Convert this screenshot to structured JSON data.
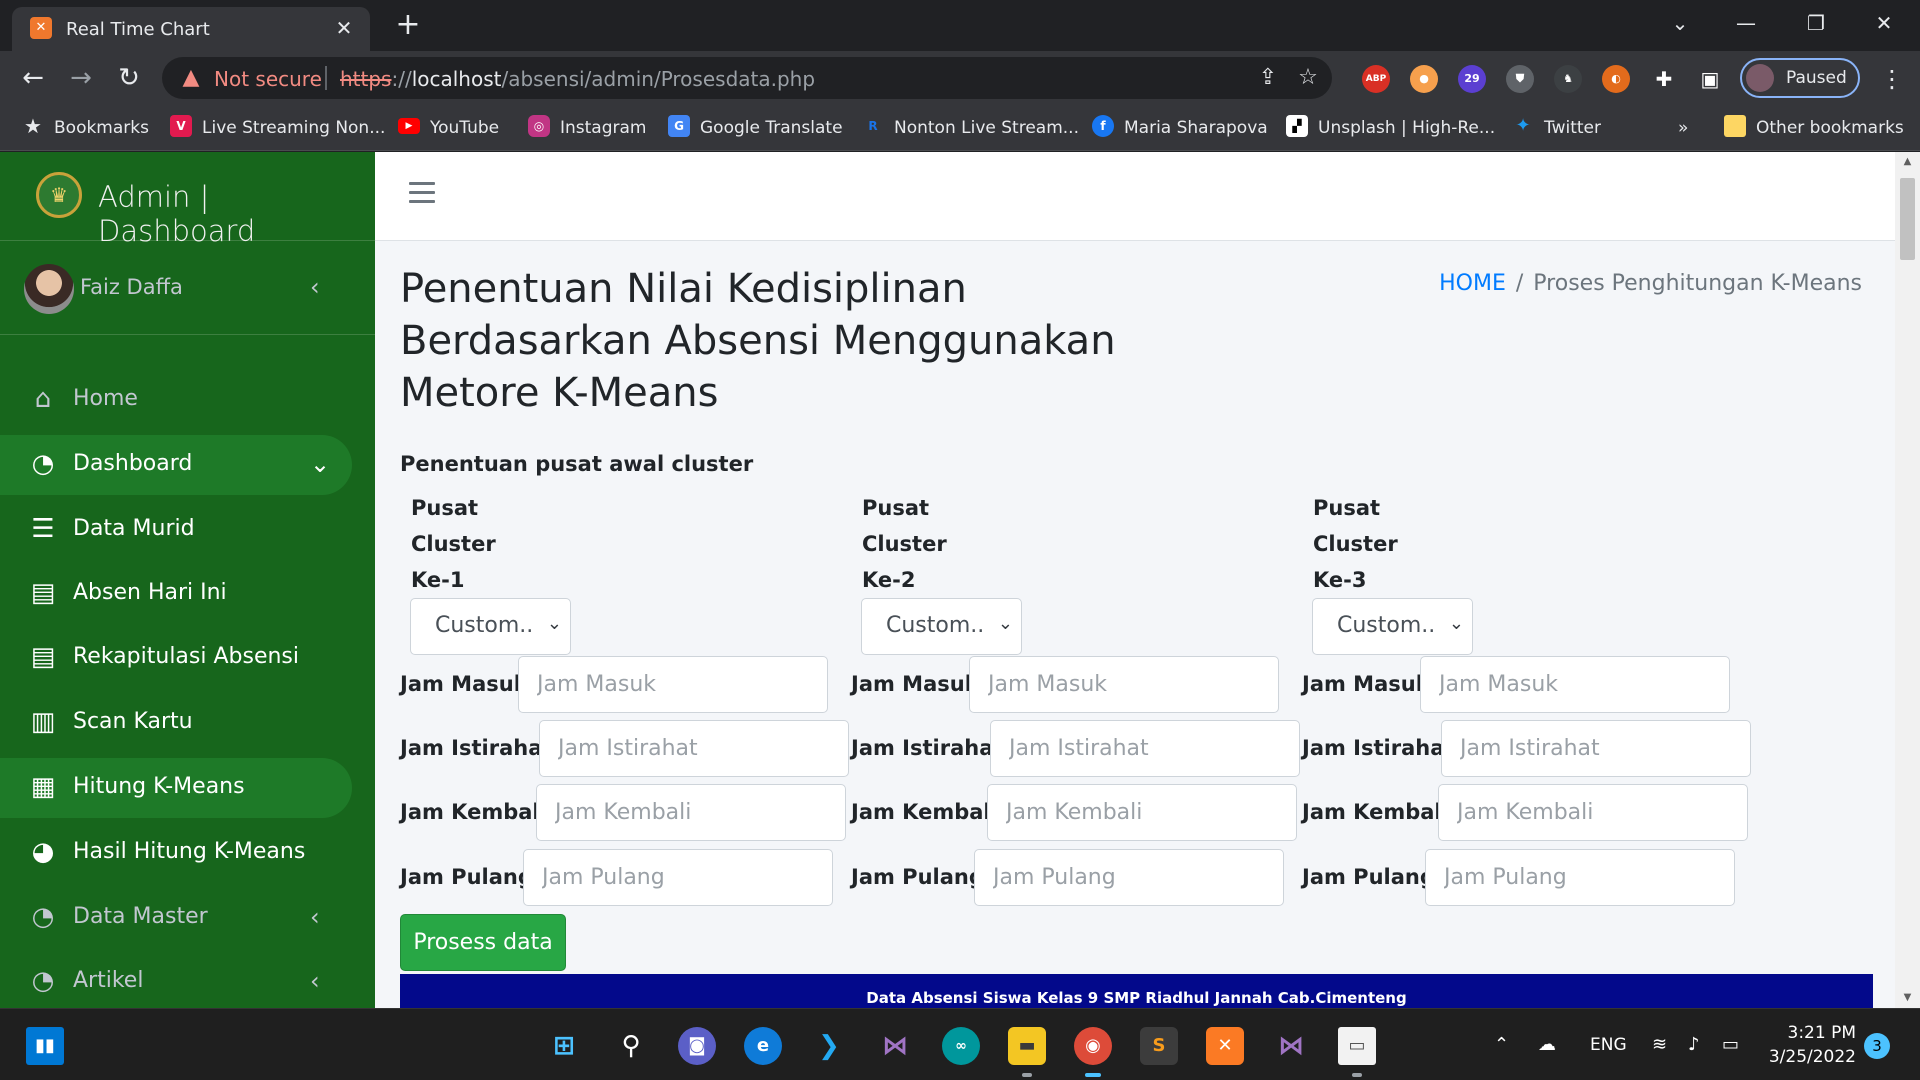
{
  "browser": {
    "tab_title": "Real Time Chart",
    "not_secure": "Not secure",
    "url_scheme": "https",
    "url_sep": "://",
    "url_host": "localhost",
    "url_path": "/absensi/admin/Prosesdata.php",
    "profile_label": "Paused",
    "ext_badge": "29",
    "bookmarks": [
      {
        "label": "Bookmarks",
        "icon": "star-icon"
      },
      {
        "label": "Live Streaming Non...",
        "icon": "vidio-icon",
        "color": "#e21a4f"
      },
      {
        "label": "YouTube",
        "icon": "youtube-icon",
        "color": "#ff0000"
      },
      {
        "label": "Instagram",
        "icon": "instagram-icon",
        "color": "#c13584"
      },
      {
        "label": "Google Translate",
        "icon": "google-translate-icon",
        "color": "#4285f4"
      },
      {
        "label": "Nonton Live Stream...",
        "icon": "live-stream-icon",
        "color": "#1a73e8"
      },
      {
        "label": "Maria Sharapova",
        "icon": "facebook-icon",
        "color": "#1877f2"
      },
      {
        "label": "Unsplash | High-Re...",
        "icon": "unsplash-icon",
        "color": "#000000"
      },
      {
        "label": "Twitter",
        "icon": "twitter-icon",
        "color": "#1d9bf0"
      }
    ],
    "more": "»",
    "other_bookmarks": "Other bookmarks"
  },
  "sidebar": {
    "brand": "Admin | Dashboard",
    "user": "Faiz Daffa",
    "items": [
      {
        "label": "Home",
        "icon": "home-icon",
        "muted": true
      },
      {
        "label": "Dashboard",
        "icon": "tachometer-icon",
        "active": true,
        "caret": "down"
      },
      {
        "label": "Data Murid",
        "icon": "database-icon"
      },
      {
        "label": "Absen Hari Ini",
        "icon": "book-icon"
      },
      {
        "label": "Rekapitulasi Absensi",
        "icon": "book-icon"
      },
      {
        "label": "Scan Kartu",
        "icon": "barcode-icon"
      },
      {
        "label": "Hitung K-Means",
        "icon": "calculator-icon",
        "active": true
      },
      {
        "label": "Hasil Hitung K-Means",
        "icon": "pie-chart-icon"
      },
      {
        "label": "Data Master",
        "icon": "tachometer-icon",
        "muted": true,
        "caret": "left"
      },
      {
        "label": "Artikel",
        "icon": "tachometer-icon",
        "muted": true,
        "caret": "left"
      }
    ]
  },
  "page": {
    "title": "Penentuan Nilai Kedisiplinan Berdasarkan Absensi Menggunakan Metore K-Means",
    "breadcrumb_home": "HOME",
    "breadcrumb_sep": "/",
    "breadcrumb_current": "Proses Penghitungan K-Means",
    "section_label": "Penentuan pusat awal cluster",
    "clusters": [
      {
        "line1": "Pusat",
        "line2": "Cluster",
        "line3": "Ke-1",
        "select": "Custom.."
      },
      {
        "line1": "Pusat",
        "line2": "Cluster",
        "line3": "Ke-2",
        "select": "Custom.."
      },
      {
        "line1": "Pusat",
        "line2": "Cluster",
        "line3": "Ke-3",
        "select": "Custom.."
      }
    ],
    "fields": [
      {
        "label": "Jam Masuk",
        "placeholder": "Jam Masuk",
        "value": ""
      },
      {
        "label": "Jam Istirahat",
        "placeholder": "Jam Istirahat",
        "value": ""
      },
      {
        "label": "Jam Kembali",
        "placeholder": "Jam Kembali",
        "value": ""
      },
      {
        "label": "Jam Pulang",
        "placeholder": "Jam Pulang",
        "value": ""
      }
    ],
    "submit_label": "Prosess data",
    "table_caption": "Data Absensi Siswa Kelas 9 SMP Riadhul Jannah Cab.Cimenteng"
  },
  "taskbar": {
    "language": "ENG",
    "time": "3:21 PM",
    "date": "3/25/2022",
    "notifications": "3"
  },
  "colors": {
    "sidebar_bg": "#17661c",
    "sidebar_active": "#1e7a28",
    "submit_button": "#28a745",
    "table_header": "#03098b",
    "link": "#007bff"
  }
}
